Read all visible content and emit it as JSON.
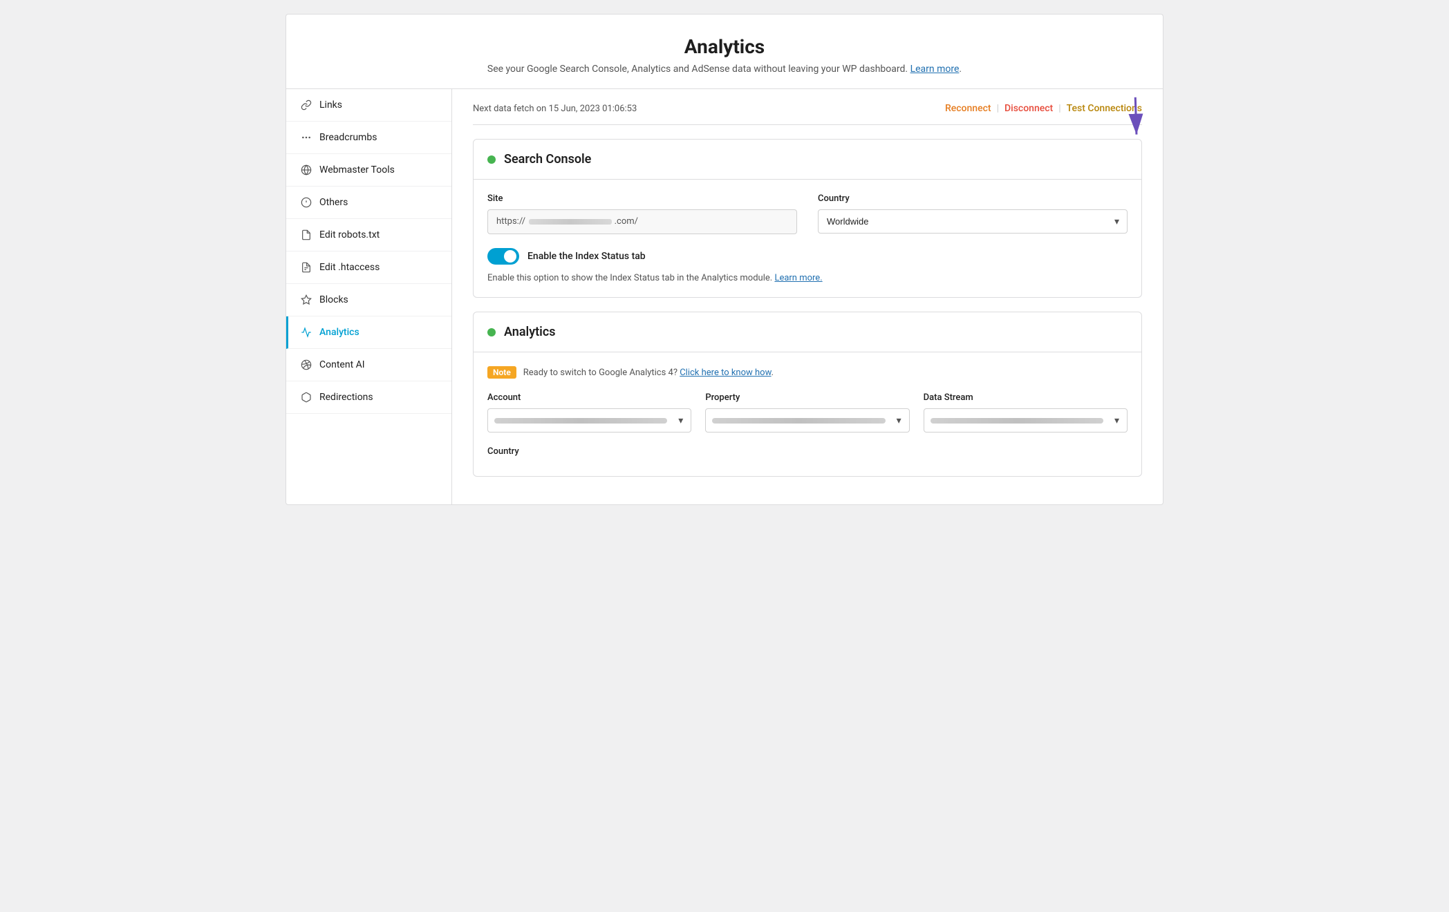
{
  "page": {
    "title": "Analytics",
    "subtitle": "See your Google Search Console, Analytics and AdSense data without leaving your WP dashboard.",
    "learn_more_label": "Learn more",
    "learn_more_url": "#"
  },
  "sidebar": {
    "items": [
      {
        "id": "links",
        "label": "Links",
        "icon": "links"
      },
      {
        "id": "breadcrumbs",
        "label": "Breadcrumbs",
        "icon": "breadcrumbs"
      },
      {
        "id": "webmaster-tools",
        "label": "Webmaster Tools",
        "icon": "webmaster"
      },
      {
        "id": "others",
        "label": "Others",
        "icon": "others"
      },
      {
        "id": "edit-robots",
        "label": "Edit robots.txt",
        "icon": "robots"
      },
      {
        "id": "edit-htaccess",
        "label": "Edit .htaccess",
        "icon": "htaccess"
      },
      {
        "id": "blocks",
        "label": "Blocks",
        "icon": "blocks"
      },
      {
        "id": "analytics",
        "label": "Analytics",
        "icon": "analytics",
        "active": true
      },
      {
        "id": "content-ai",
        "label": "Content AI",
        "icon": "content-ai"
      },
      {
        "id": "redirections",
        "label": "Redirections",
        "icon": "redirections"
      }
    ]
  },
  "topbar": {
    "next_fetch_label": "Next data fetch on 15 Jun, 2023 01:06:53",
    "reconnect_label": "Reconnect",
    "disconnect_label": "Disconnect",
    "test_connections_label": "Test Connections"
  },
  "search_console": {
    "title": "Search Console",
    "site_label": "Site",
    "site_placeholder": "https://                    .com/",
    "country_label": "Country",
    "country_value": "Worldwide",
    "toggle_label": "Enable the Index Status tab",
    "toggle_desc": "Enable this option to show the Index Status tab in the Analytics module.",
    "toggle_learn_more": "Learn more.",
    "toggle_learn_more_url": "#"
  },
  "analytics_section": {
    "title": "Analytics",
    "note_label": "Note",
    "note_text": "Ready to switch to Google Analytics 4?",
    "note_link_label": "Click here to know how",
    "note_link_url": "#",
    "account_label": "Account",
    "property_label": "Property",
    "data_stream_label": "Data Stream",
    "country_label": "Country"
  }
}
